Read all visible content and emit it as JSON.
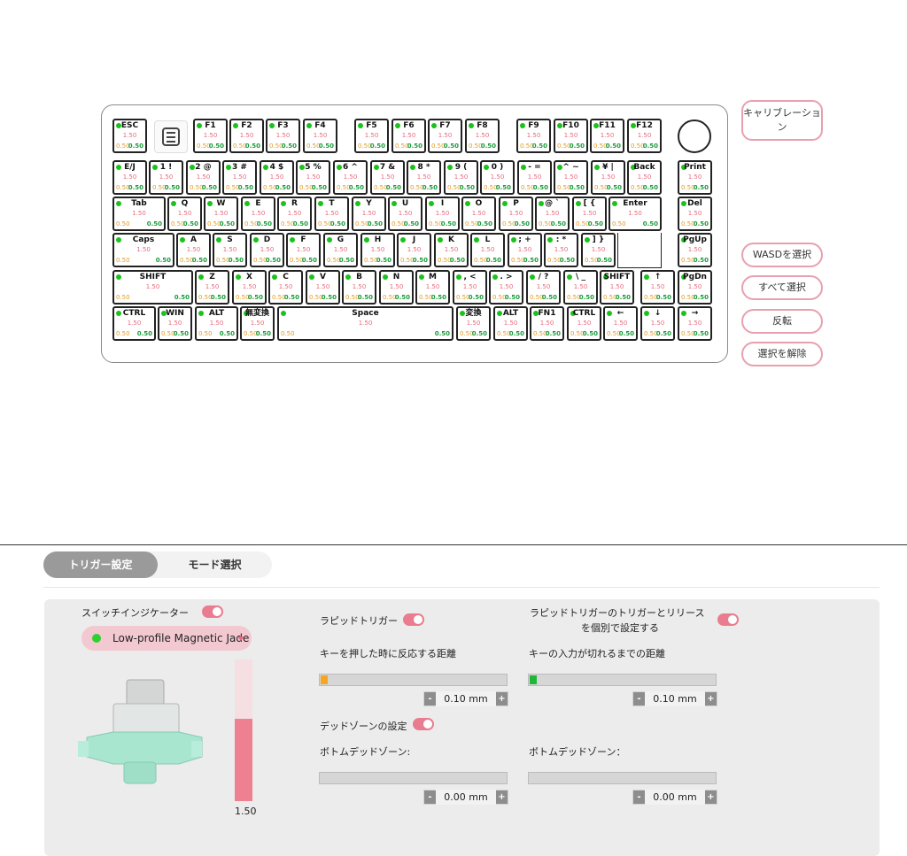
{
  "keyboard": {
    "rows": [
      [
        {
          "label": "ESC",
          "actuation": "1.50",
          "v1": "0.50",
          "v2": "0.50"
        },
        {
          "label": "F1",
          "actuation": "1.50",
          "v1": "0.50",
          "v2": "0.50"
        },
        {
          "label": "F2",
          "actuation": "1.50",
          "v1": "0.50",
          "v2": "0.50"
        },
        {
          "label": "F3",
          "actuation": "1.50",
          "v1": "0.50",
          "v2": "0.50"
        },
        {
          "label": "F4",
          "actuation": "1.50",
          "v1": "0.50",
          "v2": "0.50"
        },
        {
          "label": "F5",
          "actuation": "1.50",
          "v1": "0.50",
          "v2": "0.50"
        },
        {
          "label": "F6",
          "actuation": "1.50",
          "v1": "0.50",
          "v2": "0.50"
        },
        {
          "label": "F7",
          "actuation": "1.50",
          "v1": "0.50",
          "v2": "0.50"
        },
        {
          "label": "F8",
          "actuation": "1.50",
          "v1": "0.50",
          "v2": "0.50"
        },
        {
          "label": "F9",
          "actuation": "1.50",
          "v1": "0.50",
          "v2": "0.50"
        },
        {
          "label": "F10",
          "actuation": "1.50",
          "v1": "0.50",
          "v2": "0.50"
        },
        {
          "label": "F11",
          "actuation": "1.50",
          "v1": "0.50",
          "v2": "0.50"
        },
        {
          "label": "F12",
          "actuation": "1.50",
          "v1": "0.50",
          "v2": "0.50"
        }
      ],
      [
        {
          "label": "E/J",
          "actuation": "1.50",
          "v1": "0.50",
          "v2": "0.50"
        },
        {
          "label": "1 !",
          "actuation": "1.50",
          "v1": "0.50",
          "v2": "0.50"
        },
        {
          "label": "2 @",
          "actuation": "1.50",
          "v1": "0.50",
          "v2": "0.50"
        },
        {
          "label": "3 #",
          "actuation": "1.50",
          "v1": "0.50",
          "v2": "0.50"
        },
        {
          "label": "4 $",
          "actuation": "1.50",
          "v1": "0.50",
          "v2": "0.50"
        },
        {
          "label": "5 %",
          "actuation": "1.50",
          "v1": "0.50",
          "v2": "0.50"
        },
        {
          "label": "6 ^",
          "actuation": "1.50",
          "v1": "0.50",
          "v2": "0.50"
        },
        {
          "label": "7 &",
          "actuation": "1.50",
          "v1": "0.50",
          "v2": "0.50"
        },
        {
          "label": "8 *",
          "actuation": "1.50",
          "v1": "0.50",
          "v2": "0.50"
        },
        {
          "label": "9 (",
          "actuation": "1.50",
          "v1": "0.50",
          "v2": "0.50"
        },
        {
          "label": "0 )",
          "actuation": "1.50",
          "v1": "0.50",
          "v2": "0.50"
        },
        {
          "label": "- =",
          "actuation": "1.50",
          "v1": "0.50",
          "v2": "0.50"
        },
        {
          "label": "^ ~",
          "actuation": "1.50",
          "v1": "0.50",
          "v2": "0.50"
        },
        {
          "label": "¥ |",
          "actuation": "1.50",
          "v1": "0.50",
          "v2": "0.50"
        },
        {
          "label": "Back",
          "actuation": "1.50",
          "v1": "0.50",
          "v2": "0.50"
        },
        {
          "label": "Print",
          "actuation": "1.50",
          "v1": "0.50",
          "v2": "0.50"
        }
      ],
      [
        {
          "label": "Tab",
          "actuation": "1.50",
          "v1": "0.50",
          "v2": "0.50"
        },
        {
          "label": "Q",
          "actuation": "1.50",
          "v1": "0.50",
          "v2": "0.50"
        },
        {
          "label": "W",
          "actuation": "1.50",
          "v1": "0.50",
          "v2": "0.50"
        },
        {
          "label": "E",
          "actuation": "1.50",
          "v1": "0.50",
          "v2": "0.50"
        },
        {
          "label": "R",
          "actuation": "1.50",
          "v1": "0.50",
          "v2": "0.50"
        },
        {
          "label": "T",
          "actuation": "1.50",
          "v1": "0.50",
          "v2": "0.50"
        },
        {
          "label": "Y",
          "actuation": "1.50",
          "v1": "0.50",
          "v2": "0.50"
        },
        {
          "label": "U",
          "actuation": "1.50",
          "v1": "0.50",
          "v2": "0.50"
        },
        {
          "label": "I",
          "actuation": "1.50",
          "v1": "0.50",
          "v2": "0.50"
        },
        {
          "label": "O",
          "actuation": "1.50",
          "v1": "0.50",
          "v2": "0.50"
        },
        {
          "label": "P",
          "actuation": "1.50",
          "v1": "0.50",
          "v2": "0.50"
        },
        {
          "label": "@ `",
          "actuation": "1.50",
          "v1": "0.50",
          "v2": "0.50"
        },
        {
          "label": "[ {",
          "actuation": "1.50",
          "v1": "0.50",
          "v2": "0.50"
        },
        {
          "label": "Enter",
          "actuation": "1.50",
          "v1": "0.50",
          "v2": "0.50"
        },
        {
          "label": "Del",
          "actuation": "1.50",
          "v1": "0.50",
          "v2": "0.50"
        }
      ],
      [
        {
          "label": "Caps",
          "actuation": "1.50",
          "v1": "0.50",
          "v2": "0.50"
        },
        {
          "label": "A",
          "actuation": "1.50",
          "v1": "0.50",
          "v2": "0.50"
        },
        {
          "label": "S",
          "actuation": "1.50",
          "v1": "0.50",
          "v2": "0.50"
        },
        {
          "label": "D",
          "actuation": "1.50",
          "v1": "0.50",
          "v2": "0.50"
        },
        {
          "label": "F",
          "actuation": "1.50",
          "v1": "0.50",
          "v2": "0.50"
        },
        {
          "label": "G",
          "actuation": "1.50",
          "v1": "0.50",
          "v2": "0.50"
        },
        {
          "label": "H",
          "actuation": "1.50",
          "v1": "0.50",
          "v2": "0.50"
        },
        {
          "label": "J",
          "actuation": "1.50",
          "v1": "0.50",
          "v2": "0.50"
        },
        {
          "label": "K",
          "actuation": "1.50",
          "v1": "0.50",
          "v2": "0.50"
        },
        {
          "label": "L",
          "actuation": "1.50",
          "v1": "0.50",
          "v2": "0.50"
        },
        {
          "label": "; +",
          "actuation": "1.50",
          "v1": "0.50",
          "v2": "0.50"
        },
        {
          "label": ": *",
          "actuation": "1.50",
          "v1": "0.50",
          "v2": "0.50"
        },
        {
          "label": "] }",
          "actuation": "1.50",
          "v1": "0.50",
          "v2": "0.50"
        },
        {
          "label": "PgUp",
          "actuation": "1.50",
          "v1": "0.50",
          "v2": "0.50"
        }
      ],
      [
        {
          "label": "SHIFT",
          "actuation": "1.50",
          "v1": "0.50",
          "v2": "0.50"
        },
        {
          "label": "Z",
          "actuation": "1.50",
          "v1": "0.50",
          "v2": "0.50"
        },
        {
          "label": "X",
          "actuation": "1.50",
          "v1": "0.50",
          "v2": "0.50"
        },
        {
          "label": "C",
          "actuation": "1.50",
          "v1": "0.50",
          "v2": "0.50"
        },
        {
          "label": "V",
          "actuation": "1.50",
          "v1": "0.50",
          "v2": "0.50"
        },
        {
          "label": "B",
          "actuation": "1.50",
          "v1": "0.50",
          "v2": "0.50"
        },
        {
          "label": "N",
          "actuation": "1.50",
          "v1": "0.50",
          "v2": "0.50"
        },
        {
          "label": "M",
          "actuation": "1.50",
          "v1": "0.50",
          "v2": "0.50"
        },
        {
          "label": ", <",
          "actuation": "1.50",
          "v1": "0.50",
          "v2": "0.50"
        },
        {
          "label": ". >",
          "actuation": "1.50",
          "v1": "0.50",
          "v2": "0.50"
        },
        {
          "label": "/ ?",
          "actuation": "1.50",
          "v1": "0.50",
          "v2": "0.50"
        },
        {
          "label": "\\ _",
          "actuation": "1.50",
          "v1": "0.50",
          "v2": "0.50"
        },
        {
          "label": "SHIFT",
          "actuation": "1.50",
          "v1": "0.50",
          "v2": "0.50"
        },
        {
          "label": "↑",
          "actuation": "1.50",
          "v1": "0.50",
          "v2": "0.50"
        },
        {
          "label": "PgDn",
          "actuation": "1.50",
          "v1": "0.50",
          "v2": "0.50"
        }
      ],
      [
        {
          "label": "CTRL",
          "actuation": "1.50",
          "v1": "0.50",
          "v2": "0.50"
        },
        {
          "label": "WIN",
          "actuation": "1.50",
          "v1": "0.50",
          "v2": "0.50"
        },
        {
          "label": "ALT",
          "actuation": "1.50",
          "v1": "0.50",
          "v2": "0.50"
        },
        {
          "label": "無変換",
          "actuation": "1.50",
          "v1": "0.50",
          "v2": "0.50"
        },
        {
          "label": "Space",
          "actuation": "1.50",
          "v1": "0.50",
          "v2": "0.50"
        },
        {
          "label": "変換",
          "actuation": "1.50",
          "v1": "0.50",
          "v2": "0.50"
        },
        {
          "label": "ALT",
          "actuation": "1.50",
          "v1": "0.50",
          "v2": "0.50"
        },
        {
          "label": "FN1",
          "actuation": "1.50",
          "v1": "0.50",
          "v2": "0.50"
        },
        {
          "label": "CTRL",
          "actuation": "1.50",
          "v1": "0.50",
          "v2": "0.50"
        },
        {
          "label": "←",
          "actuation": "1.50",
          "v1": "0.50",
          "v2": "0.50"
        },
        {
          "label": "↓",
          "actuation": "1.50",
          "v1": "0.50",
          "v2": "0.50"
        },
        {
          "label": "→",
          "actuation": "1.50",
          "v1": "0.50",
          "v2": "0.50"
        }
      ]
    ]
  },
  "side_buttons": {
    "calibration": "キャリブレーション",
    "select_wasd": "WASDを選択",
    "select_all": "すべて選択",
    "invert": "反転",
    "deselect": "選択を解除"
  },
  "tabs": {
    "trigger": "トリガー設定",
    "mode": "モード選択"
  },
  "settings": {
    "switch_indicator_label": "スイッチインジケーター",
    "switch_name": "Low-profile Magnetic Jade",
    "gauge_value": "1.50",
    "gauge_level": 0.58,
    "rapid_trigger_label": "ラピッドトリガー",
    "rapid_separate_label_1": "ラピッドトリガーのトリガーとリリース",
    "rapid_separate_label_2": "を個別で設定する",
    "press_distance_label": "キーを押した時に反応する距離",
    "release_distance_label": "キーの入力が切れるまでの距離",
    "press_value": "0.10 mm",
    "release_value": "0.10 mm",
    "deadzone_label": "デッドゾーンの設定",
    "bottom_deadzone_left": "ボトムデッドゾーン:",
    "bottom_deadzone_right": "ボトムデッドゾーン：",
    "deadzone_left_value": "0.00 mm",
    "deadzone_right_value": "0.00 mm",
    "minus": "-",
    "plus": "+"
  },
  "colors": {
    "accent": "#e97d8f",
    "press_fill": "#f5a623",
    "release_fill": "#1fb63a",
    "active_dot": "#1bc21b"
  }
}
